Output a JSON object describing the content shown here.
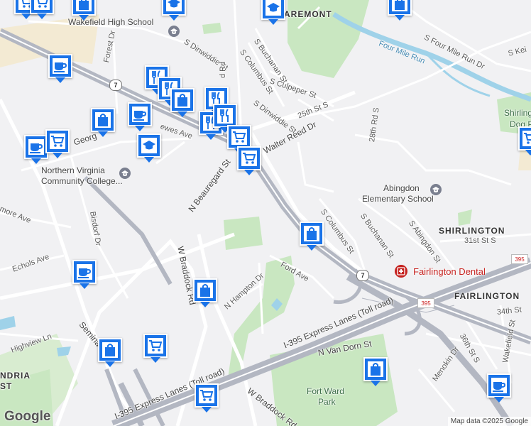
{
  "colors": {
    "background": "#f1f1f3",
    "park": "#c9e7c1",
    "water": "#9fd2e9",
    "highway": "#b3b7c2",
    "road": "#ffffff",
    "pin": "#1a73e8",
    "dental": "#c5221f"
  },
  "labels": {
    "wakefield_hs": "Wakefield High School",
    "claremont": "AREMONT",
    "four_mile_run_dr": "S Four Mile Run Dr",
    "four_mile_run": "Four Mile Run",
    "s_kei": "S Kei",
    "shirlington_dog": "Shirling",
    "dog_suffix": "Dog P",
    "s_dinwiddie_1": "S Dinwiddie St",
    "s_buchanan_1": "S Buchanan St",
    "s_columbus_1": "S Columbus St",
    "s_culpeper": "S Culpeper St",
    "s_dinwiddie_2": "S Dinwiddie St",
    "25th": "25th St S",
    "forest_dr": "Forest Dr",
    "george": "Georg",
    "lowes_ave": "ewes Ave",
    "walter_reed": "Walter Reed Dr",
    "rd_28": "28th Rd S",
    "nova_cc_1": "Northern Virginia",
    "nova_cc_2": "Community College...",
    "n_beauregard": "N Beauregard St",
    "abingdon_es_1": "Abingdon",
    "abingdon_es_2": "Elementary School",
    "shirlington": "SHIRLINGTON",
    "s_columbus_2": "S Columbus St",
    "s_buchanan_2": "S Buchanan St",
    "s_abingdon": "S Abingdon St",
    "31st": "31st St S",
    "bisdorf": "Bisdorf Dr",
    "more_ave": "more Ave",
    "w_braddock_1": "W Braddock Rd",
    "echols": "Echols Ave",
    "ford_ave": "Ford Ave",
    "fairlington_dental": "Fairlington Dental",
    "fairlington": "FAIRLINGTON",
    "n_hampton": "N Hampton Dr",
    "34th": "34th St",
    "seminary": "Semina",
    "i395_express_1": "I-395 Express Lanes (Toll road)",
    "i395_express_2": "I-395 Express Lanes (Toll road)",
    "n_van_dorn": "N Van Dorn St",
    "36th": "36th St S",
    "wakefield_st": "Wakefield St",
    "highview": "Highview Ln",
    "andria_1": "NDRIA",
    "andria_2": "ST",
    "menokin": "Menokin Dr",
    "fort_ward_1": "Fort Ward",
    "fort_ward_2": "Park",
    "w_braddock_2": "W Braddock Rd",
    "route7_a": "7",
    "route7_b": "7",
    "i395": "395",
    "i395_b": "395",
    "rd_partial": "d Rd"
  },
  "branding": {
    "logo": "Google",
    "attribution": "Map data ©2025 Google"
  },
  "pins": [
    {
      "type": "shopping-cart",
      "name": "shopping-cart-pin"
    },
    {
      "type": "shopping-bag",
      "name": "shopping-bag-pin"
    },
    {
      "type": "graduation-cap",
      "name": "school-pin"
    },
    {
      "type": "graduation-cap",
      "name": "school-pin"
    },
    {
      "type": "shopping-bag",
      "name": "shopping-bag-pin"
    },
    {
      "type": "shopping-cart",
      "name": "shopping-cart-pin"
    },
    {
      "type": "coffee-cup",
      "name": "cafe-pin"
    },
    {
      "type": "restaurant",
      "name": "restaurant-pin"
    },
    {
      "type": "restaurant",
      "name": "restaurant-pin"
    },
    {
      "type": "shopping-bag",
      "name": "shopping-bag-pin"
    },
    {
      "type": "restaurant",
      "name": "restaurant-pin"
    },
    {
      "type": "shopping-bag",
      "name": "shopping-bag-pin"
    },
    {
      "type": "coffee-cup",
      "name": "cafe-pin"
    },
    {
      "type": "restaurant",
      "name": "restaurant-pin"
    },
    {
      "type": "restaurant",
      "name": "restaurant-pin"
    },
    {
      "type": "shopping-cart",
      "name": "shopping-cart-pin"
    },
    {
      "type": "coffee-cup",
      "name": "cafe-pin"
    },
    {
      "type": "shopping-cart",
      "name": "shopping-cart-pin"
    },
    {
      "type": "graduation-cap",
      "name": "school-pin"
    },
    {
      "type": "shopping-cart",
      "name": "shopping-cart-pin"
    },
    {
      "type": "shopping-bag",
      "name": "shopping-bag-pin"
    },
    {
      "type": "coffee-cup",
      "name": "cafe-pin"
    },
    {
      "type": "shopping-bag",
      "name": "shopping-bag-pin"
    },
    {
      "type": "shopping-cart",
      "name": "shopping-cart-pin"
    },
    {
      "type": "shopping-bag",
      "name": "shopping-bag-pin"
    },
    {
      "type": "shopping-bag",
      "name": "shopping-bag-pin"
    },
    {
      "type": "shopping-cart",
      "name": "shopping-cart-pin"
    },
    {
      "type": "coffee-cup",
      "name": "cafe-pin"
    },
    {
      "type": "shopping-cart",
      "name": "shopping-cart-pin"
    }
  ]
}
